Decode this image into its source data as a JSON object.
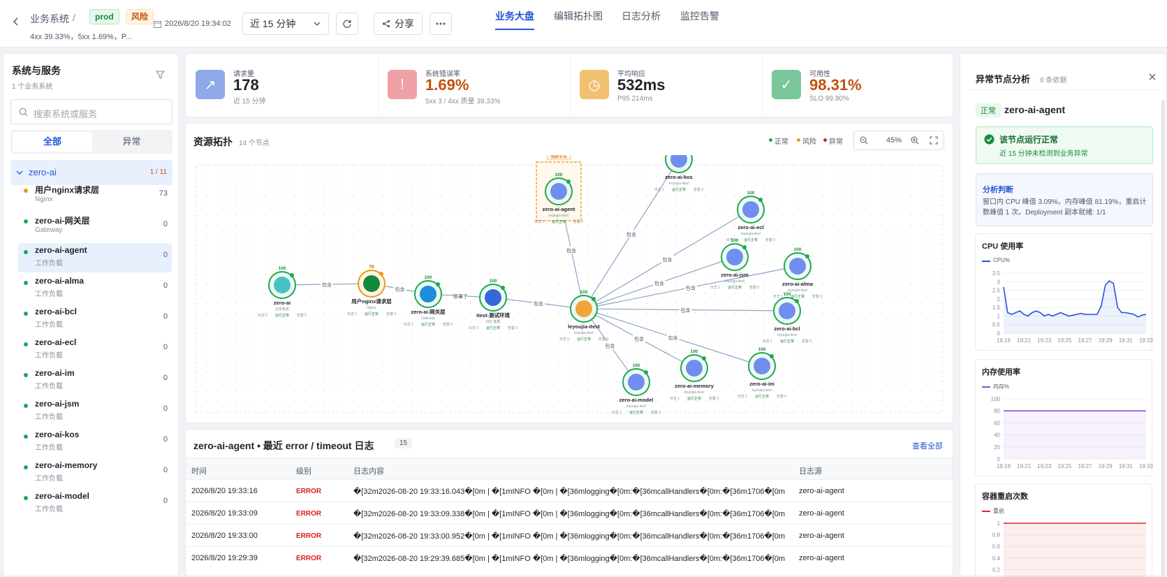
{
  "header": {
    "back_icon": "chevron-left-icon",
    "breadcrumb": "业务系统",
    "breadcrumb_sep": "/",
    "env_tag": "prod",
    "risk_tag": "风险",
    "summary": "4xx 39.33%，5xx 1.69%，P...",
    "timestamp": "2026/8/20 19:34:02",
    "time_range": "近 15 分钟",
    "share_label": "分享",
    "tabs": [
      "业务大盘",
      "编辑拓扑图",
      "日志分析",
      "监控告警"
    ]
  },
  "sidebar": {
    "title": "系统与服务",
    "subtitle": "1 个业务系统",
    "search_placeholder": "搜索系统或服务",
    "filter_all": "全部",
    "filter_abnormal": "异常",
    "group_name": "zero-ai",
    "group_count": "1 / 11",
    "items": [
      {
        "name": "用户nginx请求层",
        "type": "Nginx",
        "count": "73",
        "status": "risk"
      },
      {
        "name": "zero-ai-网关层",
        "type": "Gateway",
        "count": "0",
        "status": "ok"
      },
      {
        "name": "zero-ai-agent",
        "type": "工作负载",
        "count": "0",
        "status": "ok"
      },
      {
        "name": "zero-ai-alma",
        "type": "工作负载",
        "count": "0",
        "status": "ok"
      },
      {
        "name": "zero-ai-bcl",
        "type": "工作负载",
        "count": "0",
        "status": "ok"
      },
      {
        "name": "zero-ai-ecl",
        "type": "工作负载",
        "count": "0",
        "status": "ok"
      },
      {
        "name": "zero-ai-im",
        "type": "工作负载",
        "count": "0",
        "status": "ok"
      },
      {
        "name": "zero-ai-jsm",
        "type": "工作负载",
        "count": "0",
        "status": "ok"
      },
      {
        "name": "zero-ai-kos",
        "type": "工作负载",
        "count": "0",
        "status": "ok"
      },
      {
        "name": "zero-ai-memory",
        "type": "工作负载",
        "count": "0",
        "status": "ok"
      },
      {
        "name": "zero-ai-model",
        "type": "工作负载",
        "count": "0",
        "status": "ok"
      }
    ]
  },
  "kpis": [
    {
      "label": "请求量",
      "value": "178",
      "sub": "近 15 分钟",
      "color": "#1f2329",
      "icon": "trend-chart-icon"
    },
    {
      "label": "系统错误率",
      "value": "1.69%",
      "sub": "5xx 3 / 4xx 质量 39.33%",
      "color": "#c2520c",
      "icon": "alert-circle-icon"
    },
    {
      "label": "平均响应",
      "value": "532ms",
      "sub": "P95 214ms",
      "color": "#1f2329",
      "icon": "timer-icon"
    },
    {
      "label": "可用性",
      "value": "98.31%",
      "sub": "SLO 99.90%",
      "color": "#c2520c",
      "icon": "check-circle-icon"
    }
  ],
  "topology": {
    "title": "资源拓扑",
    "count": "14 个节点",
    "legend": [
      "正常",
      "风险",
      "异常"
    ],
    "zoom": "45%",
    "selected_badge": "当前节点",
    "nodes": [
      {
        "name": "zero-ai",
        "sub": "业务系统",
        "score": "100",
        "meta": [
          "日志 0",
          "运行正常",
          "告警 0"
        ]
      },
      {
        "name": "用户nginx请求层",
        "sub": "Nginx",
        "score": "70",
        "meta": [
          "日志 1",
          "运行正常",
          "告警 0"
        ]
      },
      {
        "name": "zero-ai-网关层",
        "sub": "Gateway",
        "score": "100",
        "meta": [
          "日志 1",
          "运行正常",
          "告警 0"
        ]
      },
      {
        "name": "itest-测试环境",
        "sub": "K8S 集群",
        "score": "100",
        "meta": [
          "日志 0",
          "运行正常",
          "告警 0"
        ]
      },
      {
        "name": "leyoujia-itest",
        "sub": "leyoujia-itest",
        "score": "100",
        "meta": [
          "日志 0",
          "运行正常",
          "告警 0"
        ]
      },
      {
        "name": "zero-ai-agent",
        "sub": "leyoujia-itest",
        "score": "100",
        "meta": [
          "日志 1",
          "运行正常",
          "告警 0"
        ]
      },
      {
        "name": "zero-ai-kos",
        "sub": "leyoujia-itest",
        "score": "",
        "meta": [
          "日志 1",
          "运行正常",
          "告警 0"
        ]
      },
      {
        "name": "zero-ai-ecl",
        "sub": "leyoujia-itest",
        "score": "100",
        "meta": [
          "日志 1",
          "运行正常",
          "告警 0"
        ]
      },
      {
        "name": "zero-ai-jsm",
        "sub": "leyoujia-itest",
        "score": "100",
        "meta": [
          "日志 1",
          "运行正常",
          "告警 0"
        ]
      },
      {
        "name": "zero-ai-alma",
        "sub": "leyoujia-itest",
        "score": "100",
        "meta": [
          "日志 1",
          "运行正常",
          "告警 0"
        ]
      },
      {
        "name": "zero-ai-bcl",
        "sub": "leyoujia-itest",
        "score": "100",
        "meta": [
          "日志 1",
          "运行正常",
          "告警 0"
        ]
      },
      {
        "name": "zero-ai-im",
        "sub": "leyoujia-itest",
        "score": "100",
        "meta": [
          "日志 1",
          "运行正常",
          "告警 0"
        ]
      },
      {
        "name": "zero-ai-memory",
        "sub": "leyoujia-itest",
        "score": "100",
        "meta": [
          "日志 1",
          "运行正常",
          "告警 0"
        ]
      },
      {
        "name": "zero-ai-model",
        "sub": "leyoujia-itest",
        "score": "100",
        "meta": [
          "日志 1",
          "运行正常",
          "告警 0"
        ]
      }
    ],
    "edge_labels": [
      "包含",
      "包含",
      "部署于",
      "包含",
      "包含",
      "包含",
      "包含",
      "包含",
      "包含",
      "包含",
      "包含",
      "包含",
      "包含"
    ]
  },
  "logs": {
    "title": "zero-ai-agent • 最近 error / timeout 日志",
    "count": "15",
    "view_all": "查看全部",
    "columns": [
      "时间",
      "级别",
      "日志内容",
      "日志源"
    ],
    "rows": [
      {
        "time": "2026/8/20 19:33:16",
        "level": "ERROR",
        "content": "�[32m2026-08-20 19:33:16.043�[0m | �[1mINFO �[0m | �[36mlogging�[0m:�[36mcallHandlers�[0m:�[36m1706�[0m - �...",
        "source": "zero-ai-agent"
      },
      {
        "time": "2026/8/20 19:33:09",
        "level": "ERROR",
        "content": "�[32m2026-08-20 19:33:09.338�[0m | �[1mINFO �[0m | �[36mlogging�[0m:�[36mcallHandlers�[0m:�[36m1706�[0m - �...",
        "source": "zero-ai-agent"
      },
      {
        "time": "2026/8/20 19:33:00",
        "level": "ERROR",
        "content": "�[32m2026-08-20 19:33:00.952�[0m | �[1mINFO �[0m | �[36mlogging�[0m:�[36mcallHandlers�[0m:�[36m1706�[0m - �...",
        "source": "zero-ai-agent"
      },
      {
        "time": "2026/8/20 19:29:39",
        "level": "ERROR",
        "content": "�[32m2026-08-20 19:29:39.685�[0m | �[1mINFO �[0m | �[36mlogging�[0m:�[36mcallHandlers�[0m:�[36m1706�[0m - �...",
        "source": "zero-ai-agent"
      }
    ]
  },
  "analysis": {
    "title": "异常节点分析",
    "evidence": "0 条依据",
    "status_tag": "正常",
    "node": "zero-ai-agent",
    "ok_title": "该节点运行正常",
    "ok_sub": "近 15 分钟未检测到业务异常",
    "judgement_title": "分析判断",
    "judgement_text": "窗口内 CPU 峰值 3.09%，内存峰值 81.19%，重启计数峰值 1 次。Deployment 副本就绪: 1/1"
  },
  "chart_data": [
    {
      "type": "line",
      "title": "CPU 使用率",
      "series": [
        {
          "name": "CPU%",
          "color": "#2553d8",
          "values": [
            2.7,
            1.2,
            1.1,
            1.2,
            1.3,
            1.1,
            1.0,
            1.2,
            1.3,
            1.2,
            1.0,
            1.1,
            1.0,
            1.1,
            1.2,
            1.1,
            1.0,
            1.05,
            1.1,
            1.15,
            1.1,
            1.1,
            1.1,
            1.1,
            1.6,
            2.8,
            3.05,
            2.9,
            1.5,
            1.2,
            1.2,
            1.15,
            1.1,
            0.95,
            1.05,
            1.1
          ]
        }
      ],
      "x": [
        "19:19",
        "19:21",
        "19:23",
        "19:25",
        "19:27",
        "19:29",
        "19:31",
        "19:33"
      ],
      "yticks": [
        "3.5",
        "3",
        "2.5",
        "2",
        "1.5",
        "1",
        "0.5",
        "0"
      ],
      "ylim": [
        0,
        3.5
      ]
    },
    {
      "type": "line",
      "title": "内存使用率",
      "series": [
        {
          "name": "内存%",
          "color": "#8b4dd8",
          "values": [
            80,
            80,
            80,
            80,
            80,
            80,
            80,
            80,
            80,
            80,
            80,
            80,
            80,
            80,
            80,
            80,
            80,
            80,
            80,
            80,
            80,
            80,
            80,
            80,
            80,
            80,
            80,
            80,
            80,
            80,
            80,
            80,
            80,
            80,
            80,
            80
          ]
        }
      ],
      "x": [
        "19:19",
        "19:21",
        "19:23",
        "19:25",
        "19:27",
        "19:29",
        "19:31",
        "19:33"
      ],
      "yticks": [
        "100",
        "80",
        "60",
        "40",
        "20",
        "0"
      ],
      "ylim": [
        0,
        100
      ]
    },
    {
      "type": "line",
      "title": "容器重启次数",
      "series": [
        {
          "name": "重启",
          "color": "#e02424",
          "values": [
            1,
            1,
            1,
            1,
            1,
            1,
            1,
            1,
            1,
            1,
            1,
            1,
            1,
            1,
            1,
            1,
            1,
            1,
            1,
            1,
            1,
            1,
            1,
            1,
            1,
            1,
            1,
            1,
            1,
            1,
            1,
            1,
            1,
            1,
            1,
            1
          ]
        }
      ],
      "x": [
        "19:19",
        "19:21",
        "19:23",
        "19:25",
        "19:27",
        "19:29",
        "19:31",
        "19:33"
      ],
      "yticks": [
        "1",
        "0.8",
        "0.6",
        "0.4",
        "0.2"
      ],
      "ylim": [
        0,
        1
      ]
    }
  ]
}
